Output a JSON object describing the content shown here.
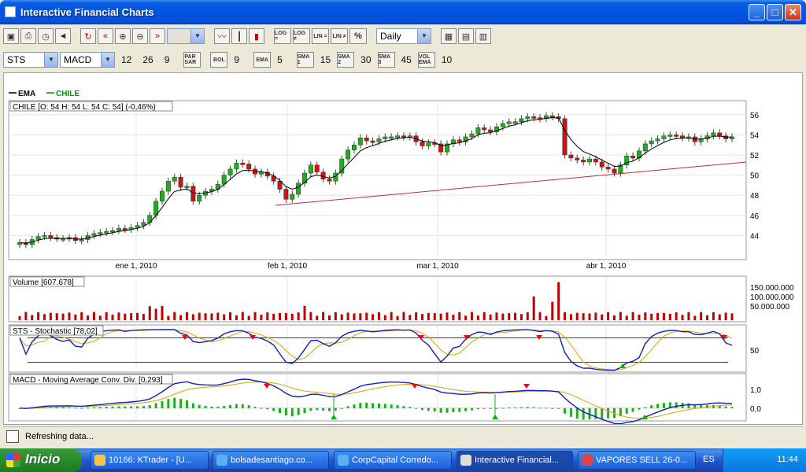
{
  "window": {
    "title": "Interactive Financial Charts"
  },
  "toolbar1": {
    "buttons": [
      "LOG =",
      "LOG ≠",
      "LIN =",
      "LIN ≠",
      "%"
    ],
    "period": "Daily"
  },
  "toolbar2": {
    "symbol": "STS",
    "indicator": "MACD",
    "macd_params": [
      "12",
      "26",
      "9"
    ],
    "par_sar": "PAR SAR",
    "bol_label": "BOL",
    "bol_value": "9",
    "ema_label": "EMA",
    "ema_value": "5",
    "sma1_label": "SMA 1",
    "sma1_value": "15",
    "sma2_label": "SMA 2",
    "sma2_value": "30",
    "sma3_label": "SMA 3",
    "sma3_value": "45",
    "vol_label": "VOL EMA",
    "vol_value": "10"
  },
  "chart_data": [
    {
      "type": "candlestick",
      "title": "CHILE [O: 54  H: 54  L: 54  C: 54] (-0,46%)",
      "legend": [
        "EMA",
        "CHILE"
      ],
      "yticks": [
        "56",
        "54",
        "52",
        "50",
        "48",
        "46",
        "44"
      ],
      "ylim": [
        42,
        57
      ],
      "xticks": [
        "ene 1, 2010",
        "feb 1, 2010",
        "mar 1, 2010",
        "abr 1, 2010"
      ],
      "close": [
        43.3,
        43.1,
        43.6,
        43.9,
        44.0,
        43.8,
        43.7,
        43.7,
        43.8,
        43.5,
        43.6,
        44.0,
        44.2,
        44.3,
        44.4,
        44.5,
        44.7,
        44.6,
        44.8,
        45.0,
        45.3,
        46.0,
        47.4,
        48.4,
        49.4,
        49.8,
        48.8,
        48.9,
        47.4,
        48.0,
        48.4,
        48.6,
        49.1,
        50.0,
        50.6,
        51.2,
        51.1,
        50.6,
        50.1,
        50.3,
        49.9,
        49.4,
        48.6,
        47.6,
        48.1,
        49.2,
        50.2,
        51.0,
        50.3,
        49.6,
        49.4,
        50.2,
        51.6,
        52.5,
        53.0,
        53.7,
        53.4,
        53.3,
        53.6,
        53.8,
        53.8,
        53.9,
        53.8,
        53.9,
        53.3,
        52.9,
        53.2,
        53.1,
        52.3,
        53.1,
        53.5,
        53.3,
        53.8,
        54.1,
        54.7,
        54.5,
        54.3,
        54.8,
        55.1,
        55.3,
        55.3,
        55.6,
        55.8,
        55.7,
        55.6,
        55.9,
        55.8,
        55.6,
        52.0,
        51.7,
        51.5,
        51.3,
        51.6,
        51.3,
        50.8,
        50.6,
        50.2,
        51.0,
        51.9,
        51.7,
        52.4,
        53.1,
        53.4,
        53.6,
        53.9,
        54.0,
        53.9,
        53.7,
        53.8,
        53.3,
        53.6,
        53.9,
        54.2,
        53.9,
        53.6,
        53.8
      ],
      "ema_line": "5-period EMA of close",
      "trendline": {
        "from": [
          "feb 1, 2010",
          47.0
        ],
        "to": [
          "end",
          51.3
        ]
      }
    },
    {
      "type": "bar",
      "title": "Volume [607.678]",
      "yticks": [
        "150.000.000",
        "100.000.000",
        "50.000.000"
      ],
      "ylim": [
        0,
        200000000
      ]
    },
    {
      "type": "line",
      "title": "STS - Stochastic [78,02]",
      "yticks": [
        "50"
      ],
      "ylim": [
        0,
        100
      ]
    },
    {
      "type": "line",
      "title": "MACD - Moving Average Conv. Div. [0,293]",
      "yticks": [
        "1,0",
        "0,0"
      ],
      "ylim": [
        -0.6,
        1.6
      ]
    }
  ],
  "status": {
    "text": "Refreshing data..."
  },
  "taskbar": {
    "start": "Inicio",
    "tasks": [
      "10166: KTrader - [U...",
      "bolsadesantiago.co...",
      "CorpCapital Corredo...",
      "Interactive Financial...",
      "VAPORES SELL 26-0..."
    ],
    "lang": "ES",
    "clock": "11:44"
  }
}
